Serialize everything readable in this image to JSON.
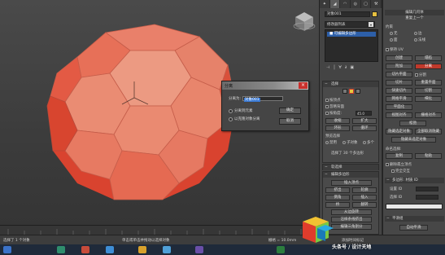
{
  "detach_dialog": {
    "title": "分离",
    "name_label": "分离为:",
    "name_value": "对象001",
    "option_to_element": "分离到元素",
    "option_as_clone": "以克隆对象分离",
    "ok_label": "确定",
    "cancel_label": "取消",
    "close_glyph": "×"
  },
  "command_panel": {
    "tabs": [
      "✦",
      "◢",
      "◠",
      "◎",
      "▢",
      "⚒"
    ],
    "object_name": "对象001",
    "modifier_list": "修改器列表",
    "stack_item": "■ 可编辑多边形",
    "stack_tools": [
      "⊣",
      "│",
      "∀",
      "∂",
      "▣"
    ],
    "selection_rollout": "选择",
    "sel_by_vertex": "按顶点",
    "ignore_backfacing": "忽略背面",
    "by_angle": "按角度:",
    "by_angle_value": "45.0",
    "shrink": "收缩",
    "grow": "扩大",
    "ring": "环形",
    "loop": "循环",
    "preview_selection": "预览选择",
    "preview_options": [
      "禁用",
      "子对象",
      "多个"
    ],
    "selected_count": "选择了 30 个多边形",
    "soft_selection": "软选择",
    "edit_polygons": "编辑多边形",
    "insert_vertex": "插入顶点",
    "extrude": "挤出",
    "outline": "轮廓",
    "bevel": "倒角",
    "inset": "插入",
    "bridge": "桥",
    "flip": "翻转",
    "from_edge": "从边旋转",
    "along_spline": "沿样条线挤出",
    "edit_triangulation": "编辑三角剖分",
    "retriangulate": "重复三角算法",
    "turn": "旋转"
  },
  "graphite_panel": {
    "title": "编辑几何体",
    "subtitle": "重复上一个",
    "constraints": "约束",
    "constraint_options": [
      "无",
      "边",
      "面",
      "法线"
    ],
    "preserve_uvs": "保持 UV",
    "create": "创建",
    "collapse": "塌陷",
    "attach": "附加",
    "detach": "分离",
    "slice_plane": "切片平面",
    "split": "分割",
    "slice": "切片",
    "reset_plane": "重置平面",
    "quickslice": "快速切片",
    "cut": "切割",
    "msmooth": "网格平滑",
    "tessellate": "细化",
    "make_planar": "平面化",
    "view_align": "视图对齐",
    "grid_align": "栅格对齐",
    "relax": "松弛",
    "hide_selected": "隐藏选定对象",
    "unhide_all": "全部取消隐藏",
    "hide_unselected": "隐藏未选定对象",
    "named_selections": "命名选择:",
    "copy": "复制",
    "paste": "粘贴",
    "delete_isolated": "删除孤立顶点",
    "full_interactivity": "完全交互",
    "material_ids": "多边形: 材质 ID",
    "set_id": "设置 ID",
    "select_id": "选择 ID",
    "smoothing_groups": "平滑组",
    "auto_smooth": "自动平滑"
  },
  "status": {
    "grid": "栅格 = 10.0mm",
    "add_time_tag": "添加时间标记",
    "selected_label": "选择了 1 个对象",
    "click_hint": "单击或单击并拖动以选择对象"
  },
  "watermark_text": "头条号 / 设计天地",
  "colors": {
    "object_face": "#e4866a",
    "object_selected": "#e8624c",
    "detach_red": "#d0362c"
  }
}
